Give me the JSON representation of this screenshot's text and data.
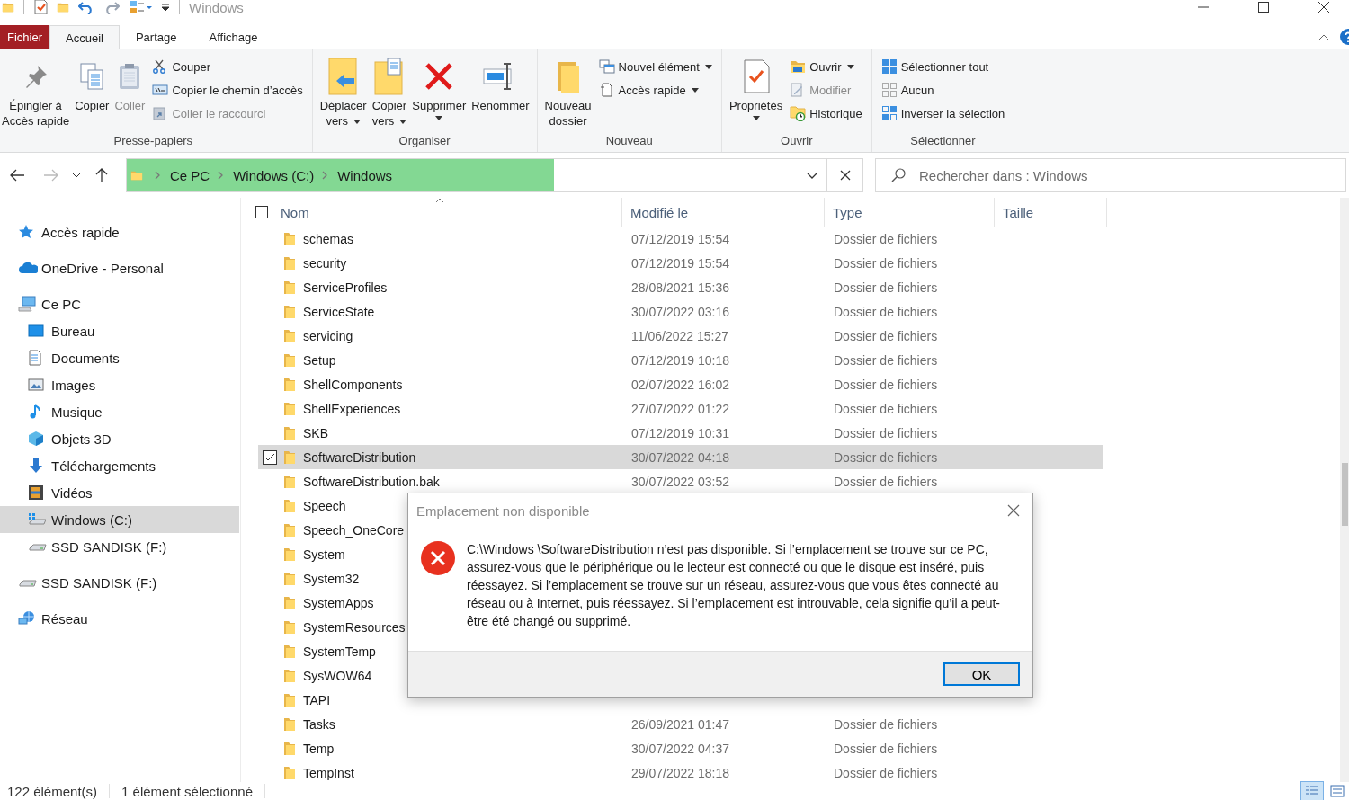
{
  "window": {
    "title": "Windows"
  },
  "ribbon_tabs": [
    {
      "label": "Fichier",
      "kind": "file",
      "selected": false
    },
    {
      "label": "Accueil",
      "kind": "tab",
      "selected": true
    },
    {
      "label": "Partage",
      "kind": "tab",
      "selected": false
    },
    {
      "label": "Affichage",
      "kind": "tab",
      "selected": false
    }
  ],
  "ribbon": {
    "groups": [
      {
        "label": "Presse-papiers",
        "items": [
          {
            "kind": "large",
            "label": "Épingler à\nAccès rapide",
            "disabled": false,
            "dropdown": false
          },
          {
            "kind": "large",
            "label": "Copier",
            "disabled": false,
            "dropdown": false
          },
          {
            "kind": "large",
            "label": "Coller",
            "disabled": true,
            "dropdown": false
          },
          {
            "kind": "stack",
            "items": [
              {
                "label": "Couper",
                "disabled": false,
                "dropdown": false
              },
              {
                "label": "Copier le chemin d’accès",
                "disabled": false,
                "dropdown": false
              },
              {
                "label": "Coller le raccourci",
                "disabled": true,
                "dropdown": false
              }
            ]
          }
        ]
      },
      {
        "label": "Organiser",
        "items": [
          {
            "kind": "large",
            "label": "Déplacer\nvers",
            "disabled": false,
            "dropdown": true
          },
          {
            "kind": "large",
            "label": "Copier\nvers",
            "disabled": false,
            "dropdown": true
          },
          {
            "kind": "large",
            "label": "Supprimer",
            "disabled": false,
            "dropdown": true
          },
          {
            "kind": "large",
            "label": "Renommer",
            "disabled": false,
            "dropdown": false
          }
        ]
      },
      {
        "label": "Nouveau",
        "items": [
          {
            "kind": "large",
            "label": "Nouveau\ndossier",
            "disabled": false,
            "dropdown": false
          },
          {
            "kind": "stack",
            "items": [
              {
                "label": "Nouvel élément",
                "disabled": false,
                "dropdown": true
              },
              {
                "label": "Accès rapide",
                "disabled": false,
                "dropdown": true
              }
            ]
          }
        ]
      },
      {
        "label": "Ouvrir",
        "items": [
          {
            "kind": "large",
            "label": "Propriétés",
            "disabled": false,
            "dropdown": true
          },
          {
            "kind": "stack",
            "items": [
              {
                "label": "Ouvrir",
                "disabled": false,
                "dropdown": true
              },
              {
                "label": "Modifier",
                "disabled": true,
                "dropdown": false
              },
              {
                "label": "Historique",
                "disabled": false,
                "dropdown": false
              }
            ]
          }
        ]
      },
      {
        "label": "Sélectionner",
        "items": [
          {
            "kind": "stack",
            "items": [
              {
                "label": "Sélectionner tout",
                "disabled": false,
                "dropdown": false
              },
              {
                "label": "Aucun",
                "disabled": false,
                "dropdown": false
              },
              {
                "label": "Inverser la sélection",
                "disabled": false,
                "dropdown": false
              }
            ]
          }
        ]
      }
    ]
  },
  "address_bar": {
    "breadcrumbs": [
      "Ce PC",
      "Windows (C:)",
      "Windows"
    ],
    "level": 0.61
  },
  "search": {
    "placeholder": "Rechercher dans : Windows"
  },
  "navigation": [
    {
      "label": "Accès rapide",
      "selected": false
    },
    {
      "label": "OneDrive - Personal",
      "selected": false
    },
    {
      "label": "Ce PC",
      "selected": false,
      "children": [
        {
          "label": "Bureau",
          "selected": false
        },
        {
          "label": "Documents",
          "selected": false
        },
        {
          "label": "Images",
          "selected": false
        },
        {
          "label": "Musique",
          "selected": false
        },
        {
          "label": "Objets 3D",
          "selected": false
        },
        {
          "label": "Téléchargements",
          "selected": false
        },
        {
          "label": "Vidéos",
          "selected": false
        },
        {
          "label": "Windows (C:)",
          "selected": true
        },
        {
          "label": "SSD SANDISK (F:)",
          "selected": false
        }
      ]
    },
    {
      "label": "SSD SANDISK (F:)",
      "selected": false
    },
    {
      "label": "Réseau",
      "selected": false
    }
  ],
  "table": {
    "select_all_checked": false,
    "columns": [
      "Nom",
      "Modifié le",
      "Type",
      "Taille"
    ],
    "rows": [
      {
        "name": "schemas",
        "modified": "07/12/2019 15:54",
        "type": "Dossier de fichiers",
        "selected": false
      },
      {
        "name": "security",
        "modified": "07/12/2019 15:54",
        "type": "Dossier de fichiers",
        "selected": false
      },
      {
        "name": "ServiceProfiles",
        "modified": "28/08/2021 15:36",
        "type": "Dossier de fichiers",
        "selected": false
      },
      {
        "name": "ServiceState",
        "modified": "30/07/2022 03:16",
        "type": "Dossier de fichiers",
        "selected": false
      },
      {
        "name": "servicing",
        "modified": "11/06/2022 15:27",
        "type": "Dossier de fichiers",
        "selected": false
      },
      {
        "name": "Setup",
        "modified": "07/12/2019 10:18",
        "type": "Dossier de fichiers",
        "selected": false
      },
      {
        "name": "ShellComponents",
        "modified": "02/07/2022 16:02",
        "type": "Dossier de fichiers",
        "selected": false
      },
      {
        "name": "ShellExperiences",
        "modified": "27/07/2022 01:22",
        "type": "Dossier de fichiers",
        "selected": false
      },
      {
        "name": "SKB",
        "modified": "07/12/2019 10:31",
        "type": "Dossier de fichiers",
        "selected": false
      },
      {
        "name": "SoftwareDistribution",
        "modified": "30/07/2022 04:18",
        "type": "Dossier de fichiers",
        "selected": true
      },
      {
        "name": "SoftwareDistribution.bak",
        "modified": "30/07/2022 03:52",
        "type": "Dossier de fichiers",
        "selected": false
      },
      {
        "name": "Speech",
        "selected": false
      },
      {
        "name": "Speech_OneCore",
        "selected": false
      },
      {
        "name": "System",
        "selected": false
      },
      {
        "name": "System32",
        "selected": false
      },
      {
        "name": "SystemApps",
        "selected": false
      },
      {
        "name": "SystemResources",
        "selected": false
      },
      {
        "name": "SystemTemp",
        "selected": false
      },
      {
        "name": "SysWOW64",
        "selected": false
      },
      {
        "name": "TAPI",
        "selected": false
      },
      {
        "name": "Tasks",
        "modified": "26/09/2021 01:47",
        "type": "Dossier de fichiers",
        "selected": false
      },
      {
        "name": "Temp",
        "modified": "30/07/2022 04:37",
        "type": "Dossier de fichiers",
        "selected": false
      },
      {
        "name": "TempInst",
        "modified": "29/07/2022 18:18",
        "type": "Dossier de fichiers",
        "selected": false
      }
    ]
  },
  "status_bar": {
    "item_count": "122 élément(s)",
    "selection": "1 élément sélectionné",
    "views": [
      {
        "selected": true
      },
      {
        "selected": false
      }
    ]
  },
  "dialog": {
    "title": "Emplacement non disponible",
    "message": "C:\\Windows \\SoftwareDistribution n’est pas disponible. Si l’emplacement se trouve sur ce PC, assurez-vous que le périphérique ou le lecteur est connecté ou que le disque est inséré, puis réessayez. Si l’emplacement se trouve sur un réseau, assurez-vous que vous êtes connecté au réseau ou à Internet, puis réessayez. Si l’emplacement est introuvable, cela signifie qu’il a peut-être été changé ou supprimé.",
    "buttons": [
      "OK"
    ]
  }
}
